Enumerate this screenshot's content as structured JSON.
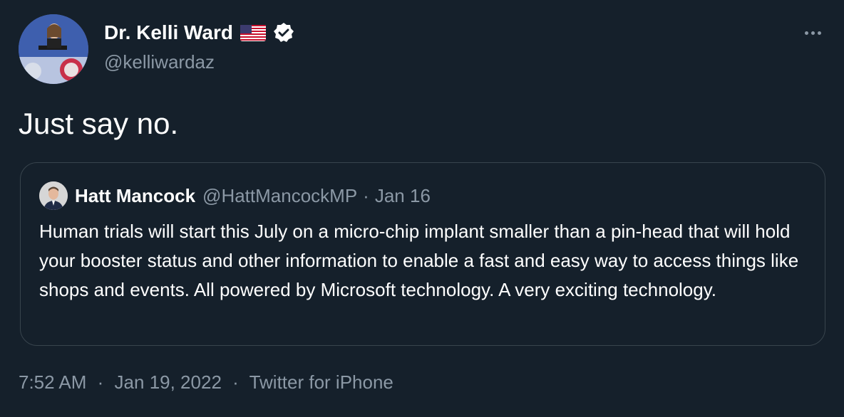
{
  "author": {
    "display_name": "Dr. Kelli Ward",
    "handle": "@kelliwardaz",
    "flag": "us-flag-icon",
    "verified": true
  },
  "tweet": {
    "text": "Just say no."
  },
  "quote": {
    "display_name": "Hatt Mancock",
    "handle": "@HattMancockMP",
    "separator": "·",
    "date": "Jan 16",
    "text": "Human trials will start this July on a micro-chip implant smaller than a pin-head that will hold your booster status and other information to enable a fast and easy way to access things like shops and events. All powered by Microsoft technology. A very exciting technology."
  },
  "footer": {
    "time": "7:52 AM",
    "date": "Jan 19, 2022",
    "separator": "·",
    "source": "Twitter for iPhone"
  },
  "colors": {
    "background": "#15202b",
    "secondary_text": "#8b98a5",
    "border": "#38444d"
  }
}
